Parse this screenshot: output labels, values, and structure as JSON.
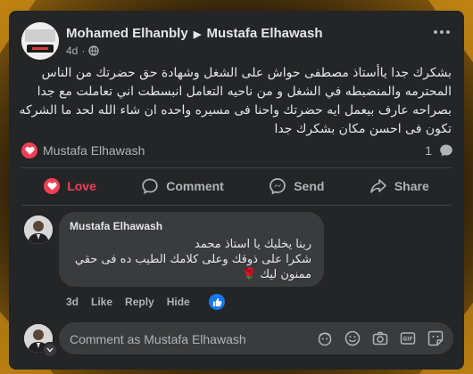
{
  "post": {
    "author": "Mohamed Elhanbly",
    "recipient": "Mustafa Elhawash",
    "time": "4d",
    "text_lines": [
      "بشكرك جدا ياأستاذ مصطفى حواش على الشغل  وشهادة حق حضرتك من الناس",
      "المحترمه والمنضبطه في الشغل و من ناحيه التعامل انبسطت اني تعاملت مع جدا",
      "بصراحه عارف بيعمل ايه حضرتك واحنا فى مسيره واحده ان شاء الله لحد ما الشركه",
      "تكون فى احسن مكان بشكرك جدا"
    ],
    "reaction_name": "Mustafa Elhawash",
    "comment_count": "1"
  },
  "actions": {
    "love": "Love",
    "comment": "Comment",
    "send": "Send",
    "share": "Share"
  },
  "comment": {
    "author": "Mustafa Elhawash",
    "lines": [
      "ربنا يخليك يا استاذ محمد",
      "شكرا على ذوقك وعلى كلامك الطيب ده فى حقي",
      "ممنون ليك 🌹"
    ],
    "time": "3d",
    "like": "Like",
    "reply": "Reply",
    "hide": "Hide"
  },
  "composer": {
    "placeholder": "Comment as Mustafa Elhawash"
  },
  "colors": {
    "love": "#f33e58",
    "like": "#1877f2",
    "card": "#242526",
    "bubble": "#3a3b3c"
  }
}
